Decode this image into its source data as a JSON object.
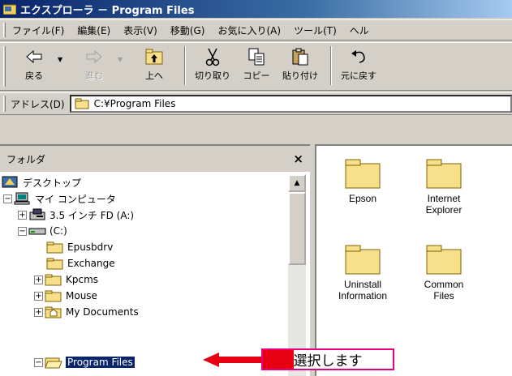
{
  "window": {
    "title": "エクスプローラ － Program Files"
  },
  "menu": [
    "ファイル(F)",
    "編集(E)",
    "表示(V)",
    "移動(G)",
    "お気に入り(A)",
    "ツール(T)",
    "ヘル"
  ],
  "toolbar": [
    {
      "label": "戻る",
      "icon": "back-arrow-icon",
      "enabled": true
    },
    {
      "label": "進む",
      "icon": "forward-arrow-icon",
      "enabled": false
    },
    {
      "label": "上へ",
      "icon": "up-folder-icon",
      "enabled": true
    },
    {
      "label": "切り取り",
      "icon": "scissors-icon",
      "enabled": true
    },
    {
      "label": "コピー",
      "icon": "copy-icon",
      "enabled": true
    },
    {
      "label": "貼り付け",
      "icon": "paste-icon",
      "enabled": true
    },
    {
      "label": "元に戻す",
      "icon": "undo-icon",
      "enabled": true
    }
  ],
  "address": {
    "label": "アドレス(D)",
    "value": "C:¥Program Files"
  },
  "folder_pane": {
    "title": "フォルダ",
    "close": "×",
    "tree": [
      {
        "label": "デスクトップ",
        "icon": "desktop-icon",
        "expander": "",
        "selected": false
      },
      {
        "label": "マイ コンピュータ",
        "icon": "computer-icon",
        "expander": "−",
        "selected": false
      },
      {
        "label": "3.5 インチ FD (A:)",
        "icon": "floppy-drive-icon",
        "expander": "+",
        "selected": false
      },
      {
        "label": "(C:)",
        "icon": "hard-drive-icon",
        "expander": "−",
        "selected": false
      },
      {
        "label": "Epusbdrv",
        "icon": "folder-icon",
        "expander": "",
        "selected": false
      },
      {
        "label": "Exchange",
        "icon": "folder-icon",
        "expander": "",
        "selected": false
      },
      {
        "label": "Kpcms",
        "icon": "folder-icon",
        "expander": "+",
        "selected": false
      },
      {
        "label": "Mouse",
        "icon": "folder-icon",
        "expander": "+",
        "selected": false
      },
      {
        "label": "My Documents",
        "icon": "my-documents-folder-icon",
        "expander": "+",
        "selected": false
      },
      {
        "label": "Program Files",
        "icon": "open-folder-icon",
        "expander": "−",
        "selected": true
      }
    ]
  },
  "content_items": [
    {
      "label": "Epson",
      "icon": "folder-icon"
    },
    {
      "label": "Internet Explorer",
      "icon": "folder-icon"
    },
    {
      "label": "Uninstall Information",
      "icon": "folder-icon"
    },
    {
      "label": "Common Files",
      "icon": "folder-icon"
    }
  ],
  "annotation": {
    "text": "選択します",
    "color": "#e60012"
  },
  "colors": {
    "selection": "#0a246a",
    "folder": "#f7e08c",
    "title_gradient_start": "#0a246a"
  }
}
